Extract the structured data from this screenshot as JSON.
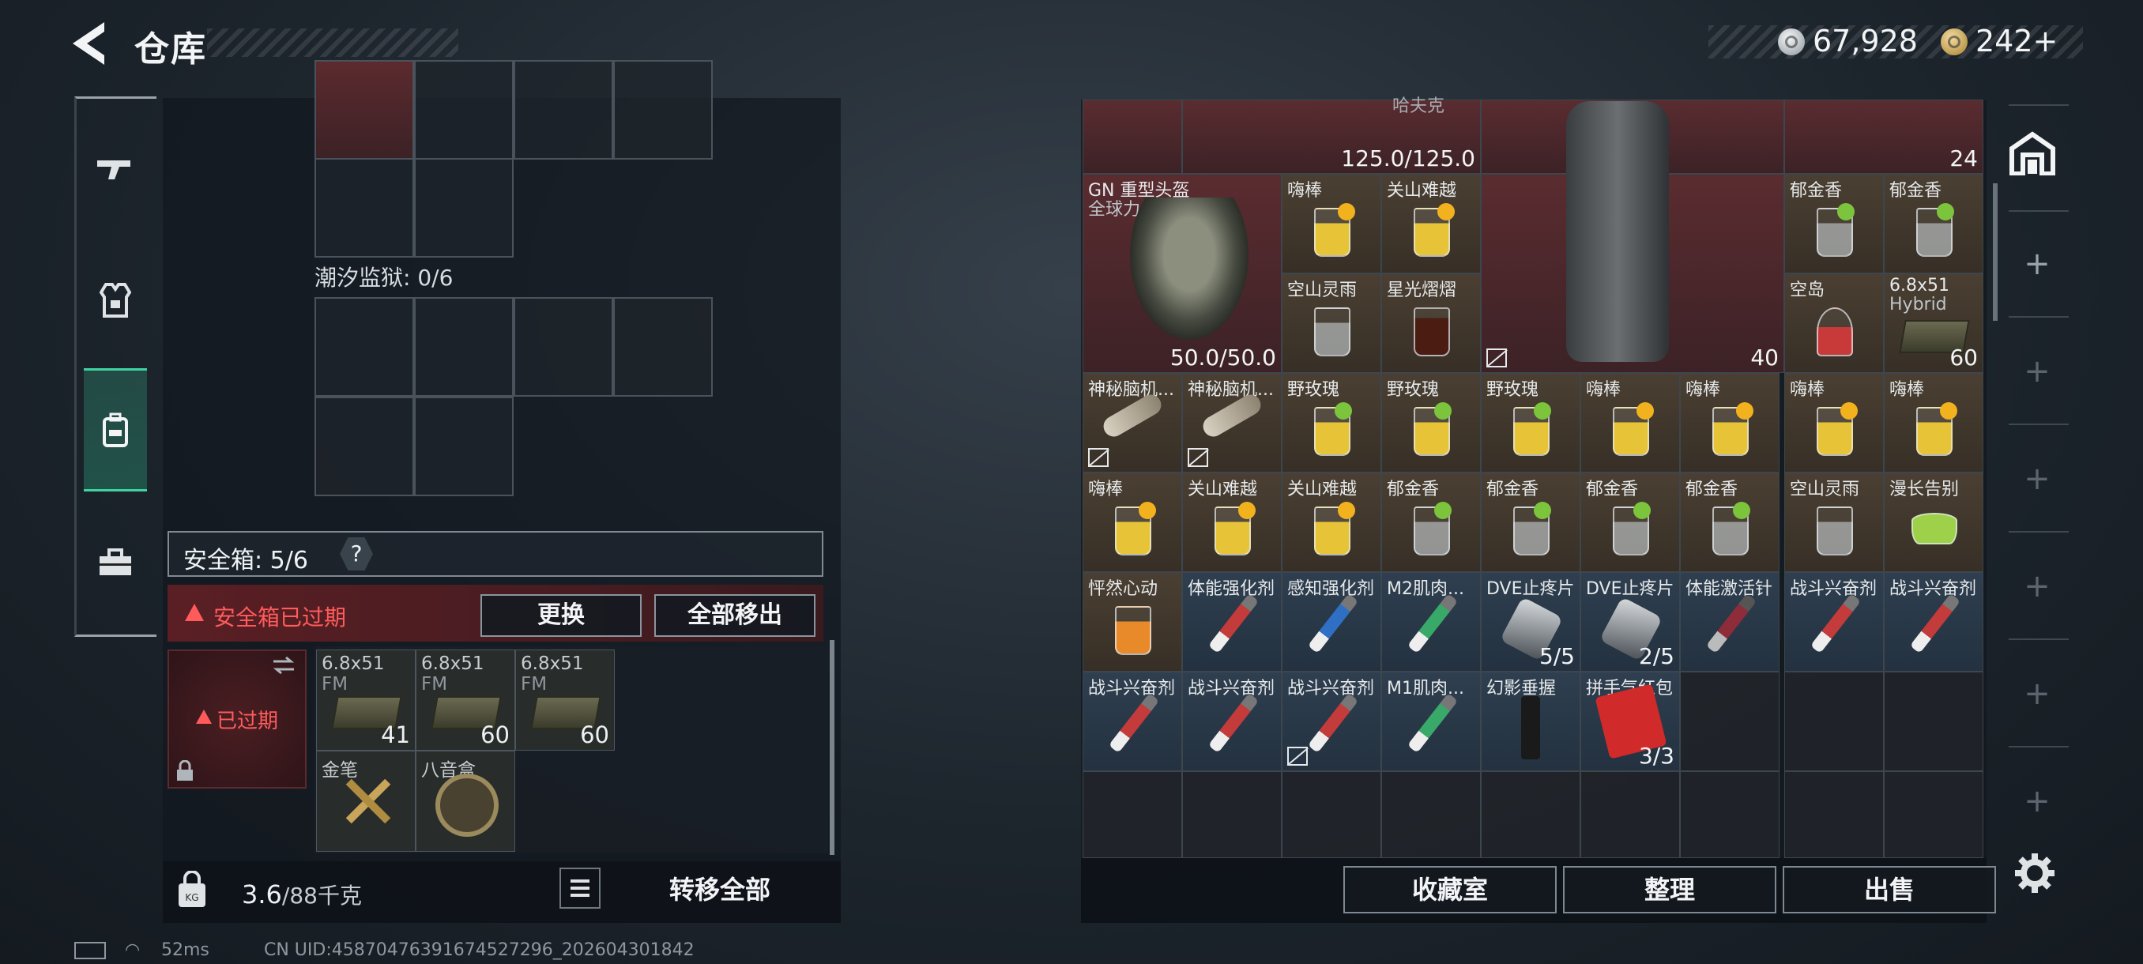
{
  "header": {
    "title": "仓库",
    "coins": "67,928",
    "tokens": "242+"
  },
  "left": {
    "tide_prison": "潮汐监狱: 0/6",
    "safebox_label": "安全箱: 5/6",
    "safebox_help": "?",
    "expired_warning": "安全箱已过期",
    "replace_button": "更换",
    "move_all_button": "全部移出",
    "safe_slot_status": "已过期",
    "items": [
      {
        "name": "6.8x51",
        "name2": "FM",
        "count": "41"
      },
      {
        "name": "6.8x51",
        "name2": "FM",
        "count": "60"
      },
      {
        "name": "6.8x51",
        "name2": "FM",
        "count": "60"
      },
      {
        "name": "金笔",
        "name2": "",
        "count": ""
      },
      {
        "name": "八音盒",
        "name2": "",
        "count": ""
      }
    ],
    "weight_current": "3.6",
    "weight_max": "/88千克",
    "transfer_button": "转移全部"
  },
  "status": {
    "ping": "52ms",
    "uid": "CN UID:45870476391674527296_202604301842"
  },
  "right": {
    "top_partial_label": "哈夫克",
    "durability_top": "125.0/125.0",
    "stack_top": "24",
    "helmet_name": "GN 重型头盔",
    "helmet_sub": "全球力量",
    "helmet_durability": "50.0/50.0",
    "vest_capacity": "40",
    "cells": {
      "r1c2": "嗨棒",
      "r1c3": "关山难越",
      "r1c7": "郁金香",
      "r1c8": "郁金香",
      "r2c2": "空山灵雨",
      "r2c3": "星光熠熠",
      "r2c7": "空岛",
      "r2c8": "6.8x51",
      "r2c8b": "Hybrid",
      "r2c8cnt": "60",
      "r3c0": "神秘脑机...",
      "r3c1": "神秘脑机...",
      "r3c2": "野玫瑰",
      "r3c3": "野玫瑰",
      "r3c4": "野玫瑰",
      "r3c5": "嗨棒",
      "r3c6": "嗨棒",
      "r3c7": "嗨棒",
      "r3c8": "嗨棒",
      "r4c0": "嗨棒",
      "r4c1": "关山难越",
      "r4c2": "关山难越",
      "r4c3": "郁金香",
      "r4c4": "郁金香",
      "r4c5": "郁金香",
      "r4c6": "郁金香",
      "r4c7": "空山灵雨",
      "r4c8": "漫长告别",
      "r5c0": "怦然心动",
      "r5c1": "体能强化剂",
      "r5c2": "感知强化剂",
      "r5c3": "M2肌肉...",
      "r5c4": "DVE止疼片",
      "r5c4cnt": "5/5",
      "r5c5": "DVE止疼片",
      "r5c5cnt": "2/5",
      "r5c6": "体能激活针",
      "r5c7": "战斗兴奋剂",
      "r5c8": "战斗兴奋剂",
      "r6c0": "战斗兴奋剂",
      "r6c1": "战斗兴奋剂",
      "r6c2": "战斗兴奋剂",
      "r6c3": "M1肌肉...",
      "r6c4": "幻影垂握",
      "r6c5": "拼手气红包",
      "r6c5cnt": "3/3"
    },
    "collection_button": "收藏室",
    "sort_button": "整理",
    "sell_button": "出售"
  },
  "icons": [
    "back-arrow-icon",
    "silver-coin-icon",
    "gold-token-icon",
    "rifle-icon",
    "armor-icon",
    "backpack-icon",
    "toolbox-icon",
    "warehouse-icon",
    "plus-icon",
    "gear-icon",
    "weight-lock-icon",
    "list-icon",
    "no-bind-icon"
  ]
}
